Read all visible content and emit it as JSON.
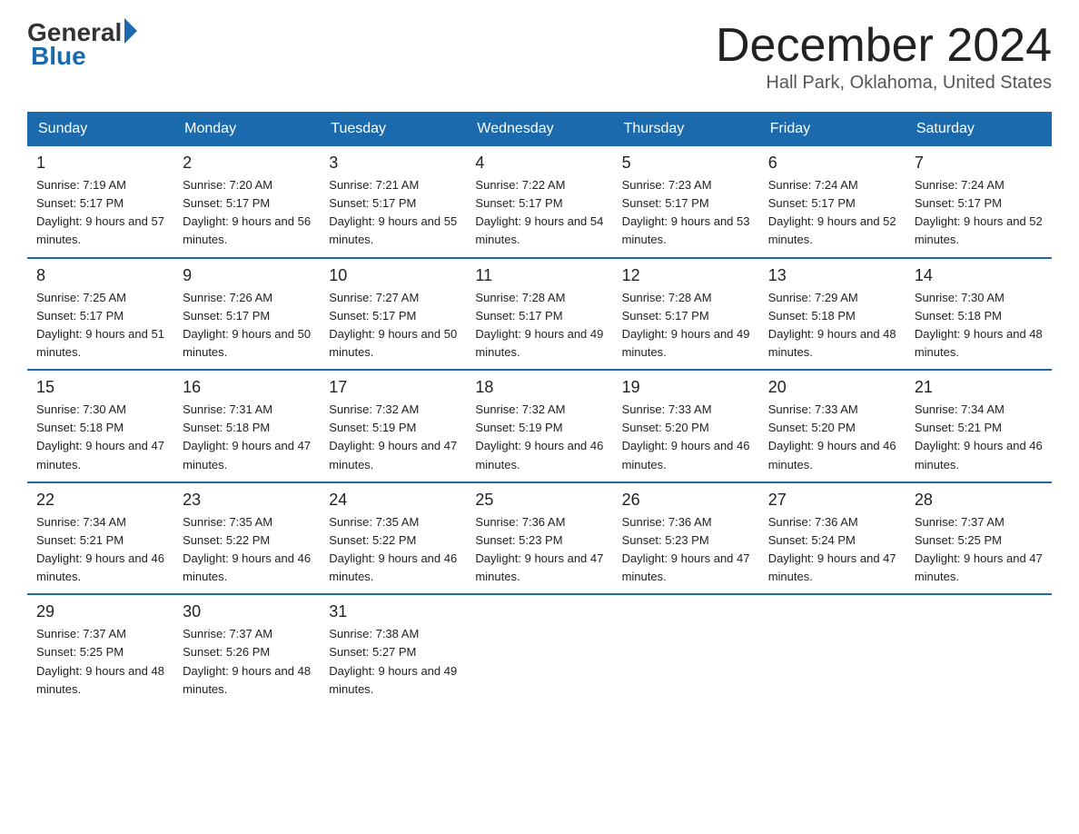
{
  "logo": {
    "general": "General",
    "blue": "Blue"
  },
  "title": "December 2024",
  "location": "Hall Park, Oklahoma, United States",
  "days_of_week": [
    "Sunday",
    "Monday",
    "Tuesday",
    "Wednesday",
    "Thursday",
    "Friday",
    "Saturday"
  ],
  "weeks": [
    [
      {
        "date": "1",
        "sunrise": "7:19 AM",
        "sunset": "5:17 PM",
        "daylight": "9 hours and 57 minutes."
      },
      {
        "date": "2",
        "sunrise": "7:20 AM",
        "sunset": "5:17 PM",
        "daylight": "9 hours and 56 minutes."
      },
      {
        "date": "3",
        "sunrise": "7:21 AM",
        "sunset": "5:17 PM",
        "daylight": "9 hours and 55 minutes."
      },
      {
        "date": "4",
        "sunrise": "7:22 AM",
        "sunset": "5:17 PM",
        "daylight": "9 hours and 54 minutes."
      },
      {
        "date": "5",
        "sunrise": "7:23 AM",
        "sunset": "5:17 PM",
        "daylight": "9 hours and 53 minutes."
      },
      {
        "date": "6",
        "sunrise": "7:24 AM",
        "sunset": "5:17 PM",
        "daylight": "9 hours and 52 minutes."
      },
      {
        "date": "7",
        "sunrise": "7:24 AM",
        "sunset": "5:17 PM",
        "daylight": "9 hours and 52 minutes."
      }
    ],
    [
      {
        "date": "8",
        "sunrise": "7:25 AM",
        "sunset": "5:17 PM",
        "daylight": "9 hours and 51 minutes."
      },
      {
        "date": "9",
        "sunrise": "7:26 AM",
        "sunset": "5:17 PM",
        "daylight": "9 hours and 50 minutes."
      },
      {
        "date": "10",
        "sunrise": "7:27 AM",
        "sunset": "5:17 PM",
        "daylight": "9 hours and 50 minutes."
      },
      {
        "date": "11",
        "sunrise": "7:28 AM",
        "sunset": "5:17 PM",
        "daylight": "9 hours and 49 minutes."
      },
      {
        "date": "12",
        "sunrise": "7:28 AM",
        "sunset": "5:17 PM",
        "daylight": "9 hours and 49 minutes."
      },
      {
        "date": "13",
        "sunrise": "7:29 AM",
        "sunset": "5:18 PM",
        "daylight": "9 hours and 48 minutes."
      },
      {
        "date": "14",
        "sunrise": "7:30 AM",
        "sunset": "5:18 PM",
        "daylight": "9 hours and 48 minutes."
      }
    ],
    [
      {
        "date": "15",
        "sunrise": "7:30 AM",
        "sunset": "5:18 PM",
        "daylight": "9 hours and 47 minutes."
      },
      {
        "date": "16",
        "sunrise": "7:31 AM",
        "sunset": "5:18 PM",
        "daylight": "9 hours and 47 minutes."
      },
      {
        "date": "17",
        "sunrise": "7:32 AM",
        "sunset": "5:19 PM",
        "daylight": "9 hours and 47 minutes."
      },
      {
        "date": "18",
        "sunrise": "7:32 AM",
        "sunset": "5:19 PM",
        "daylight": "9 hours and 46 minutes."
      },
      {
        "date": "19",
        "sunrise": "7:33 AM",
        "sunset": "5:20 PM",
        "daylight": "9 hours and 46 minutes."
      },
      {
        "date": "20",
        "sunrise": "7:33 AM",
        "sunset": "5:20 PM",
        "daylight": "9 hours and 46 minutes."
      },
      {
        "date": "21",
        "sunrise": "7:34 AM",
        "sunset": "5:21 PM",
        "daylight": "9 hours and 46 minutes."
      }
    ],
    [
      {
        "date": "22",
        "sunrise": "7:34 AM",
        "sunset": "5:21 PM",
        "daylight": "9 hours and 46 minutes."
      },
      {
        "date": "23",
        "sunrise": "7:35 AM",
        "sunset": "5:22 PM",
        "daylight": "9 hours and 46 minutes."
      },
      {
        "date": "24",
        "sunrise": "7:35 AM",
        "sunset": "5:22 PM",
        "daylight": "9 hours and 46 minutes."
      },
      {
        "date": "25",
        "sunrise": "7:36 AM",
        "sunset": "5:23 PM",
        "daylight": "9 hours and 47 minutes."
      },
      {
        "date": "26",
        "sunrise": "7:36 AM",
        "sunset": "5:23 PM",
        "daylight": "9 hours and 47 minutes."
      },
      {
        "date": "27",
        "sunrise": "7:36 AM",
        "sunset": "5:24 PM",
        "daylight": "9 hours and 47 minutes."
      },
      {
        "date": "28",
        "sunrise": "7:37 AM",
        "sunset": "5:25 PM",
        "daylight": "9 hours and 47 minutes."
      }
    ],
    [
      {
        "date": "29",
        "sunrise": "7:37 AM",
        "sunset": "5:25 PM",
        "daylight": "9 hours and 48 minutes."
      },
      {
        "date": "30",
        "sunrise": "7:37 AM",
        "sunset": "5:26 PM",
        "daylight": "9 hours and 48 minutes."
      },
      {
        "date": "31",
        "sunrise": "7:38 AM",
        "sunset": "5:27 PM",
        "daylight": "9 hours and 49 minutes."
      },
      null,
      null,
      null,
      null
    ]
  ]
}
